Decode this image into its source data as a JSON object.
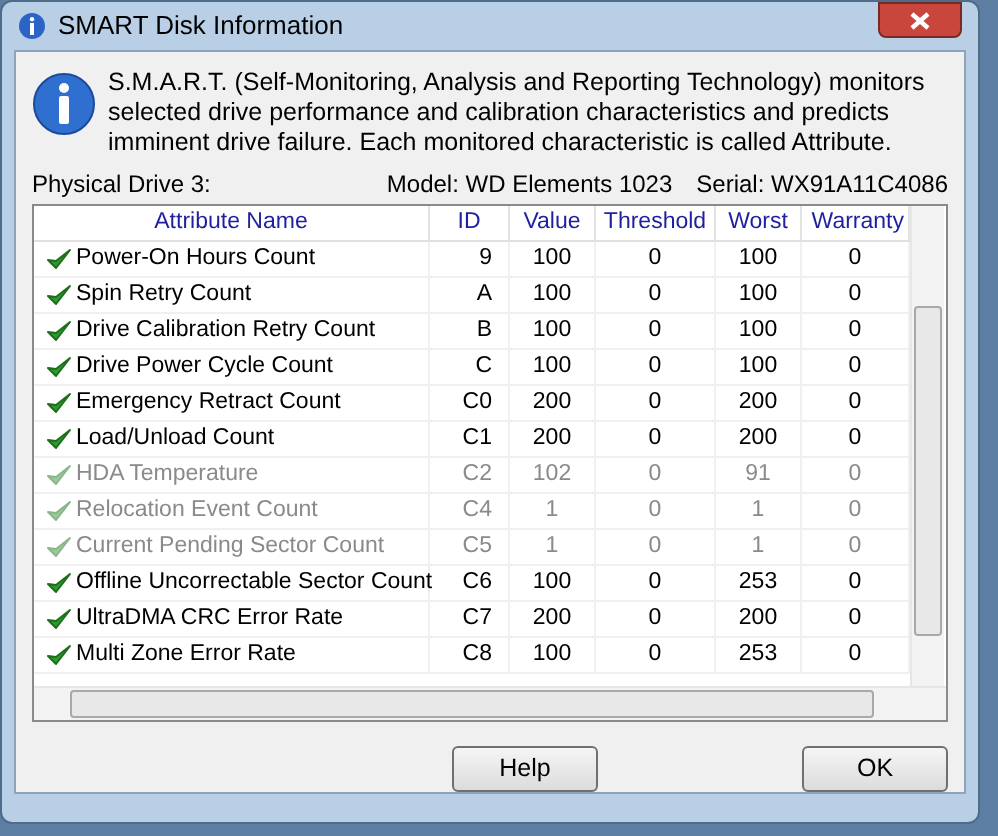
{
  "window": {
    "title": "SMART Disk Information"
  },
  "description": "S.M.A.R.T. (Self-Monitoring, Analysis and Reporting Technology) monitors selected drive performance and calibration characteristics and predicts imminent drive failure. Each monitored characteristic is called Attribute.",
  "drive": {
    "label": "Physical Drive 3:",
    "model": "Model: WD Elements 1023",
    "serial": "Serial: WX91A11C4086"
  },
  "table": {
    "columns": [
      "Attribute Name",
      "ID",
      "Value",
      "Threshold",
      "Worst",
      "Warranty"
    ],
    "rows": [
      {
        "name": "Power-On Hours Count",
        "id": "9",
        "value": "100",
        "threshold": "0",
        "worst": "100",
        "warranty": "0",
        "disabled": false
      },
      {
        "name": "Spin Retry Count",
        "id": "A",
        "value": "100",
        "threshold": "0",
        "worst": "100",
        "warranty": "0",
        "disabled": false
      },
      {
        "name": "Drive Calibration Retry Count",
        "id": "B",
        "value": "100",
        "threshold": "0",
        "worst": "100",
        "warranty": "0",
        "disabled": false
      },
      {
        "name": "Drive Power Cycle Count",
        "id": "C",
        "value": "100",
        "threshold": "0",
        "worst": "100",
        "warranty": "0",
        "disabled": false
      },
      {
        "name": "Emergency Retract Count",
        "id": "C0",
        "value": "200",
        "threshold": "0",
        "worst": "200",
        "warranty": "0",
        "disabled": false
      },
      {
        "name": "Load/Unload Count",
        "id": "C1",
        "value": "200",
        "threshold": "0",
        "worst": "200",
        "warranty": "0",
        "disabled": false
      },
      {
        "name": "HDA Temperature",
        "id": "C2",
        "value": "102",
        "threshold": "0",
        "worst": "91",
        "warranty": "0",
        "disabled": true
      },
      {
        "name": "Relocation Event Count",
        "id": "C4",
        "value": "1",
        "threshold": "0",
        "worst": "1",
        "warranty": "0",
        "disabled": true
      },
      {
        "name": "Current Pending Sector Count",
        "id": "C5",
        "value": "1",
        "threshold": "0",
        "worst": "1",
        "warranty": "0",
        "disabled": true
      },
      {
        "name": "Offline Uncorrectable Sector Count",
        "id": "C6",
        "value": "100",
        "threshold": "0",
        "worst": "253",
        "warranty": "0",
        "disabled": false
      },
      {
        "name": "UltraDMA CRC Error Rate",
        "id": "C7",
        "value": "200",
        "threshold": "0",
        "worst": "200",
        "warranty": "0",
        "disabled": false
      },
      {
        "name": "Multi Zone Error Rate",
        "id": "C8",
        "value": "100",
        "threshold": "0",
        "worst": "253",
        "warranty": "0",
        "disabled": false
      }
    ]
  },
  "buttons": [
    "Help",
    "OK"
  ]
}
